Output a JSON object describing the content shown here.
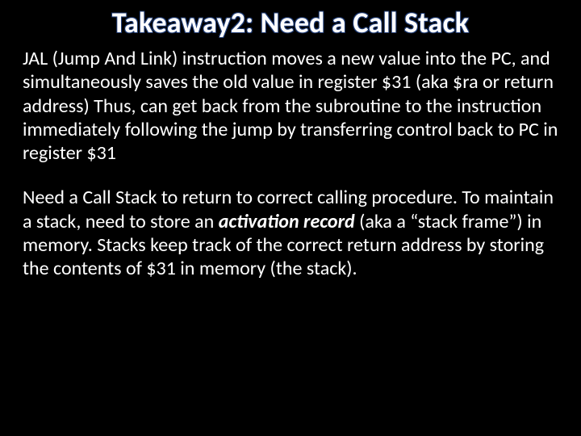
{
  "title": "Takeaway2: Need a Call Stack",
  "p1": "JAL (Jump And Link) instruction moves a new value into the PC, and simultaneously saves the old value in register $31 (aka $ra or return address) Thus, can get back from the subroutine to the instruction immediately following the jump by transferring control back to PC in register $31",
  "p2a": "Need a Call Stack to return to correct calling procedure.  To maintain a stack, need to store an ",
  "p2_em": "activation record",
  "p2b": " (aka a “stack frame”) in memory. Stacks keep track of the correct return address by storing the contents of $31 in memory (the stack)."
}
